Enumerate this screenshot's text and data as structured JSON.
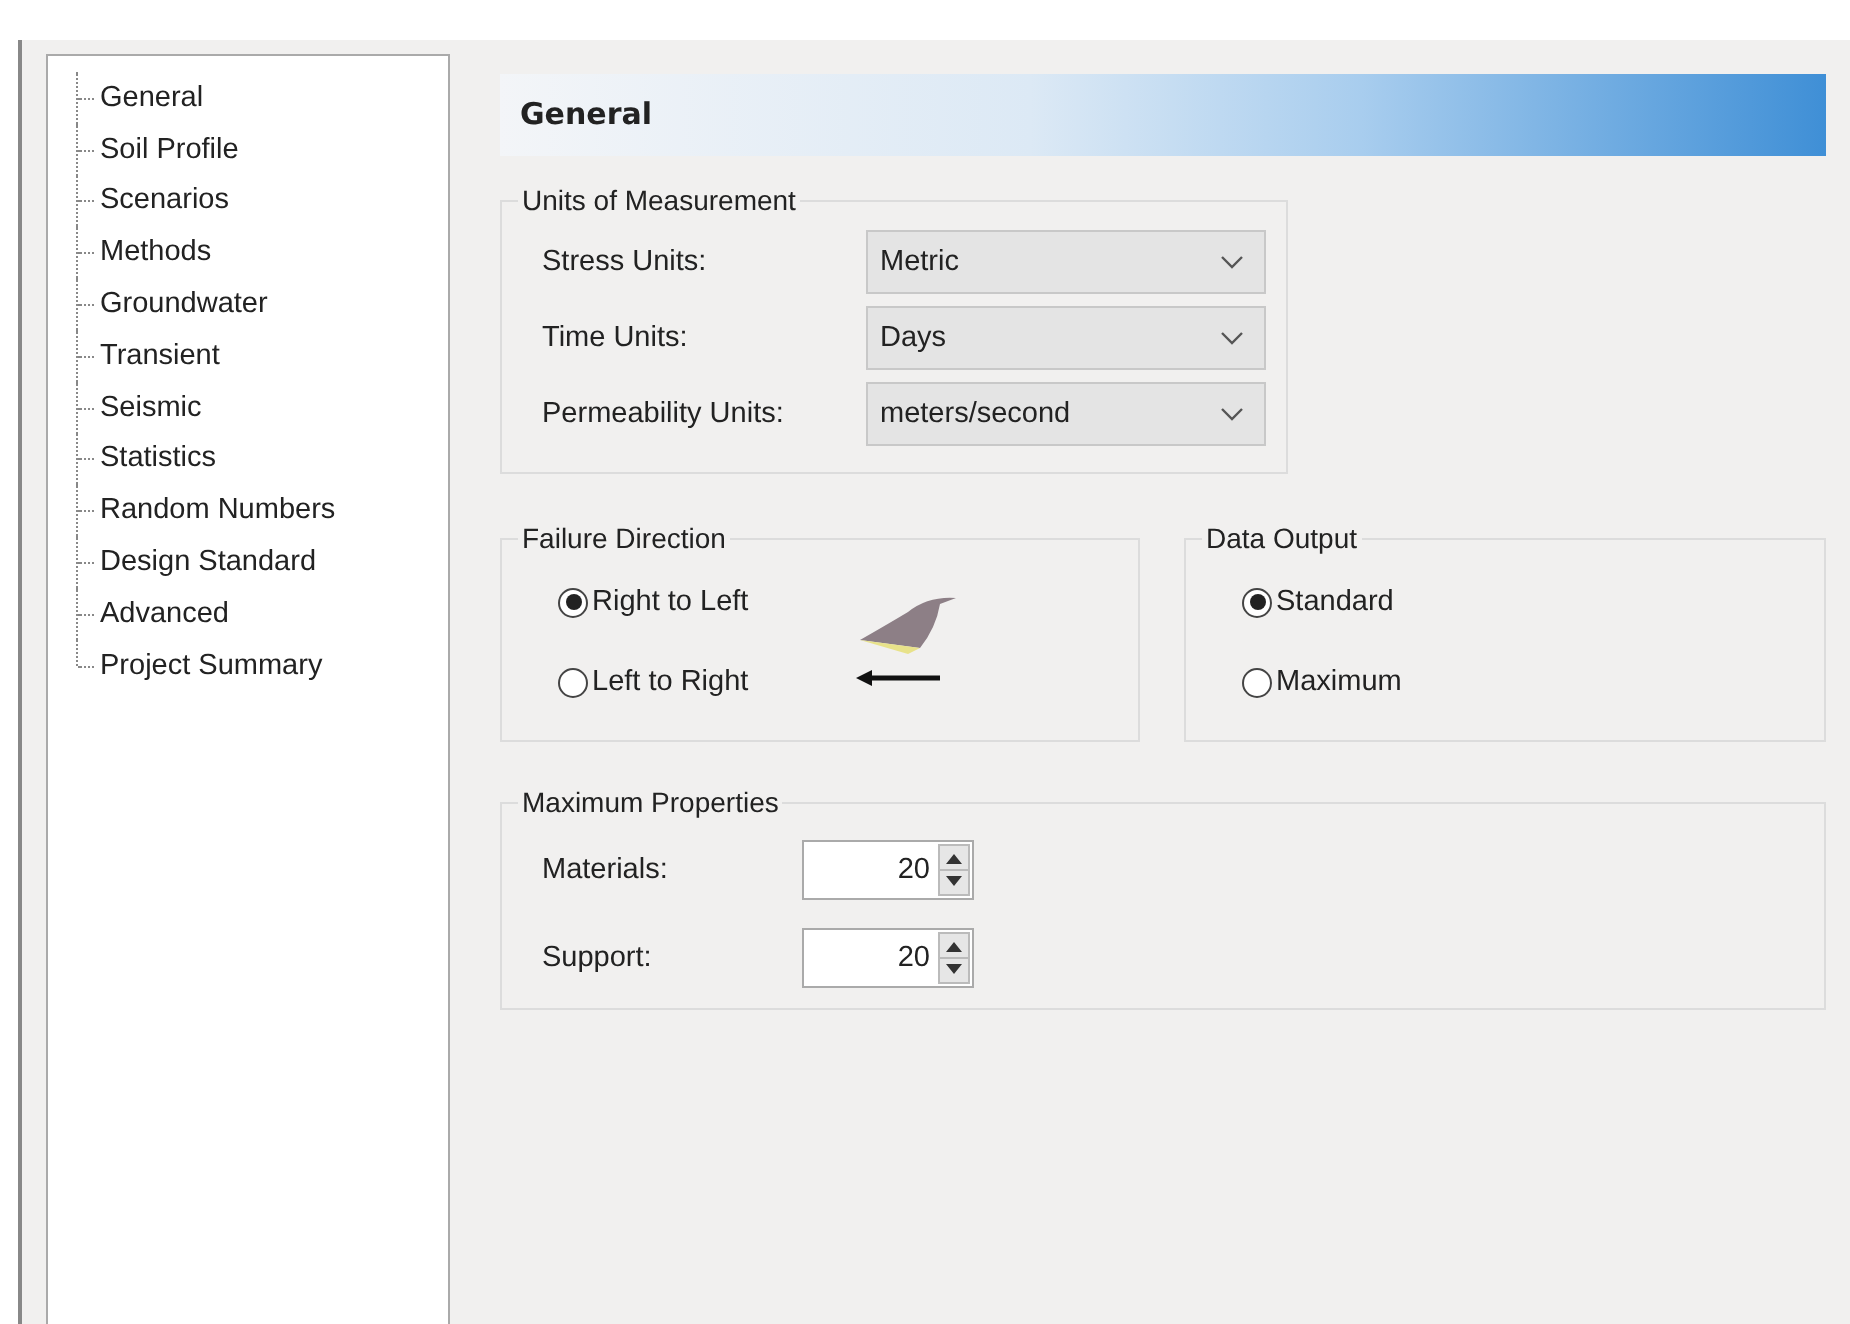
{
  "tree": {
    "items": [
      {
        "label": "General"
      },
      {
        "label": "Soil Profile"
      },
      {
        "label": "Scenarios"
      },
      {
        "label": "Methods"
      },
      {
        "label": "Groundwater"
      },
      {
        "label": "Transient"
      },
      {
        "label": "Seismic"
      },
      {
        "label": "Statistics"
      },
      {
        "label": "Random Numbers"
      },
      {
        "label": "Design Standard"
      },
      {
        "label": "Advanced"
      },
      {
        "label": "Project Summary"
      }
    ]
  },
  "header": {
    "title": "General"
  },
  "units": {
    "title": "Units of Measurement",
    "rows": [
      {
        "label": "Stress Units:",
        "value": "Metric"
      },
      {
        "label": "Time Units:",
        "value": "Days"
      },
      {
        "label": "Permeability Units:",
        "value": "meters/second"
      }
    ]
  },
  "failure_direction": {
    "title": "Failure Direction",
    "options": [
      {
        "label": "Right to Left",
        "selected": true
      },
      {
        "label": "Left to Right",
        "selected": false
      }
    ]
  },
  "data_output": {
    "title": "Data Output",
    "options": [
      {
        "label": "Standard",
        "selected": true
      },
      {
        "label": "Maximum",
        "selected": false
      }
    ]
  },
  "max_properties": {
    "title": "Maximum Properties",
    "rows": [
      {
        "label": "Materials:",
        "value": "20"
      },
      {
        "label": "Support:",
        "value": "20"
      }
    ]
  }
}
